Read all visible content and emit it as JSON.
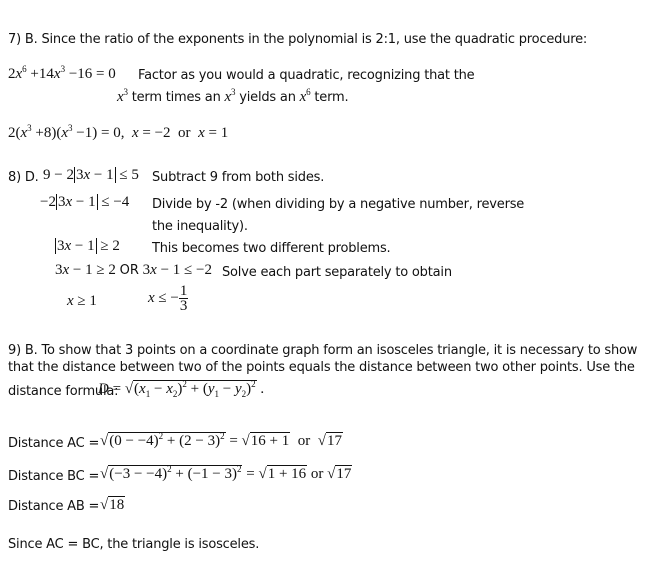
{
  "q7": {
    "heading": "7) B.  Since the ratio of the exponents in the polynomial is 2:1, use the quadratic procedure:",
    "equation": "2x⁶ + 14x³ − 16 = 0",
    "note_line1": "Factor as you would a quadratic, recognizing that the",
    "note_line2_parts": [
      "x³",
      "term times an",
      "x³",
      "yields an",
      "x⁶",
      "term."
    ],
    "factored": "2(x³ + 8)(x³ − 1) = 0,  x = −2  or  x = 1"
  },
  "q8": {
    "label": "8) D.",
    "step1_math": "9 − 2|3x − 1| ≤ 5",
    "step1_note": "Subtract 9 from both sides.",
    "step2_math": "−2|3x − 1| ≤ −4",
    "step2_note_line1": "Divide by -2 (when dividing by a negative number, reverse",
    "step2_note_line2": "the inequality).",
    "step3_math": "|3x − 1| ≥ 2",
    "step3_note": "This becomes two different problems.",
    "step4_math_a": "3x − 1 ≥ 2",
    "step4_or": "OR",
    "step4_math_b": "3x − 1 ≤ −2",
    "step4_note": "Solve each part separately to obtain",
    "result_a": "x ≥ 1",
    "result_b_prefix": "x ≤ −",
    "result_b_num": "1",
    "result_b_den": "3"
  },
  "q9": {
    "line1": "9) B.  To show that 3 points on a coordinate graph form an isosceles triangle, it is necessary to show",
    "line2": "that the distance between two of the points equals the distance between two other points.  Use the",
    "line3_label": "distance formula:",
    "formula": "D = √((x₁ − x₂)² + (y₁ − y₂)²)",
    "ac_label": "Distance AC =",
    "ac_expr": "(0 − −4)² + (2 − 3)²",
    "ac_mid": "16 + 1",
    "ac_result": "17",
    "bc_label": "Distance BC =",
    "bc_expr": "(−3 − −4)² + (−1 − 3)²",
    "bc_mid": "1 + 16",
    "bc_result": "17",
    "ab_label": "Distance AB =",
    "ab_result": "18",
    "conclusion": "Since AC = BC, the triangle is isosceles.",
    "or_word": "or"
  }
}
